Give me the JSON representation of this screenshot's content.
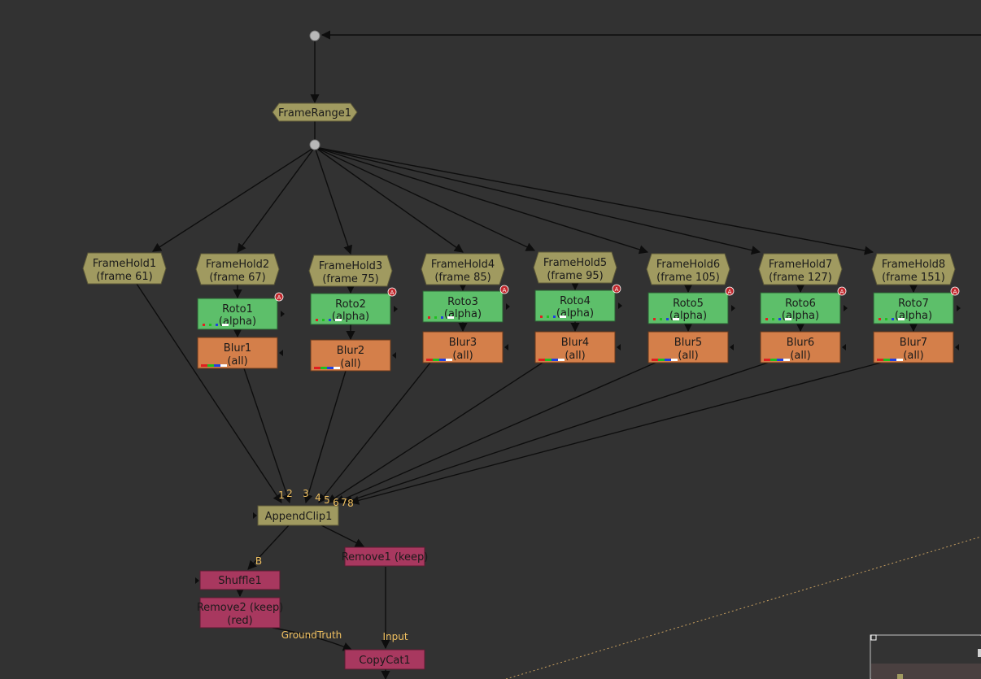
{
  "colors": {
    "background": "#323232",
    "time_node": "#a09a60",
    "roto_node": "#5dbf6a",
    "blur_node": "#d47f4a",
    "channel_node": "#a8385f",
    "append_node": "#a09a60",
    "port_label": "#f0c060",
    "mask_badge": "#c0282d"
  },
  "nodes": {
    "frame_range": "FrameRange1",
    "append_clip": "AppendClip1",
    "shuffle": "Shuffle1",
    "remove1": "Remove1 (keep)",
    "remove2": [
      "Remove2 (keep)",
      "(red)"
    ],
    "copycat": "CopyCat1",
    "frameholds": [
      {
        "name": "FrameHold1",
        "frame": "(frame 61)"
      },
      {
        "name": "FrameHold2",
        "frame": "(frame 67)"
      },
      {
        "name": "FrameHold3",
        "frame": "(frame 75)"
      },
      {
        "name": "FrameHold4",
        "frame": "(frame 85)"
      },
      {
        "name": "FrameHold5",
        "frame": "(frame 95)"
      },
      {
        "name": "FrameHold6",
        "frame": "(frame 105)"
      },
      {
        "name": "FrameHold7",
        "frame": "(frame 127)"
      },
      {
        "name": "FrameHold8",
        "frame": "(frame 151)"
      }
    ],
    "rotos": [
      {
        "name": "Roto1",
        "channel": "(alpha)"
      },
      {
        "name": "Roto2",
        "channel": "(alpha)"
      },
      {
        "name": "Roto3",
        "channel": "(alpha)"
      },
      {
        "name": "Roto4",
        "channel": "(alpha)"
      },
      {
        "name": "Roto5",
        "channel": "(alpha)"
      },
      {
        "name": "Roto6",
        "channel": "(alpha)"
      },
      {
        "name": "Roto7",
        "channel": "(alpha)"
      }
    ],
    "blurs": [
      {
        "name": "Blur1",
        "channel": "(all)"
      },
      {
        "name": "Blur2",
        "channel": "(all)"
      },
      {
        "name": "Blur3",
        "channel": "(all)"
      },
      {
        "name": "Blur4",
        "channel": "(all)"
      },
      {
        "name": "Blur5",
        "channel": "(all)"
      },
      {
        "name": "Blur6",
        "channel": "(all)"
      },
      {
        "name": "Blur7",
        "channel": "(all)"
      }
    ],
    "mask_badge": "A"
  },
  "ports": {
    "append_inputs": [
      "1",
      "2",
      "3",
      "4",
      "5",
      "6",
      "7",
      "8"
    ],
    "shuffle_input": "B",
    "groundtruth": "GroundTruth",
    "input": "Input"
  }
}
